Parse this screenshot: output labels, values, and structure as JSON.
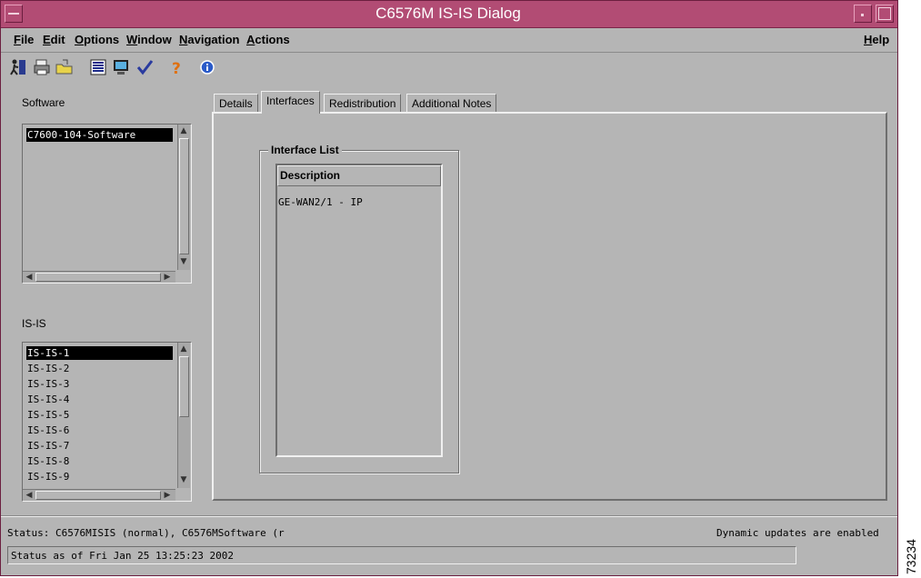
{
  "window": {
    "title": "C6576M IS-IS Dialog"
  },
  "menubar": {
    "items": [
      {
        "pre": "",
        "u": "F",
        "post": "ile"
      },
      {
        "pre": "",
        "u": "E",
        "post": "dit"
      },
      {
        "pre": "",
        "u": "O",
        "post": "ptions"
      },
      {
        "pre": "",
        "u": "W",
        "post": "indow"
      },
      {
        "pre": "",
        "u": "N",
        "post": "avigation"
      },
      {
        "pre": "",
        "u": "A",
        "post": "ctions"
      }
    ],
    "help": {
      "pre": "",
      "u": "H",
      "post": "elp"
    }
  },
  "toolbar": {
    "icons": [
      "exit-icon",
      "print-icon",
      "open-folder-icon",
      "list-icon",
      "monitor-icon",
      "checkmark-icon",
      "help-icon",
      "info-icon"
    ]
  },
  "software_panel": {
    "label": "Software",
    "items": [
      "C7600-104-Software"
    ],
    "selected_index": 0
  },
  "isis_panel": {
    "label": "IS-IS",
    "items": [
      "IS-IS-1",
      "IS-IS-2",
      "IS-IS-3",
      "IS-IS-4",
      "IS-IS-5",
      "IS-IS-6",
      "IS-IS-7",
      "IS-IS-8",
      "IS-IS-9"
    ],
    "selected_index": 0
  },
  "tabs": [
    {
      "label": "Details",
      "active": false
    },
    {
      "label": "Interfaces",
      "active": true
    },
    {
      "label": "Redistribution",
      "active": false
    },
    {
      "label": "Additional Notes",
      "active": false
    }
  ],
  "interface_list": {
    "group_label": "Interface List",
    "column_header": "Description",
    "rows": [
      "GE-WAN2/1 - IP"
    ]
  },
  "status": {
    "line": "Status: C6576MISIS (normal), C6576MSoftware (r",
    "updates": "Dynamic updates are enabled",
    "timestamp": "Status as of Fri Jan 25 13:25:23 2002"
  },
  "figure_number": "73234",
  "colors": {
    "titlebar": "#b24c74",
    "window_bg": "#b5b5b5",
    "selection": "#000000"
  }
}
